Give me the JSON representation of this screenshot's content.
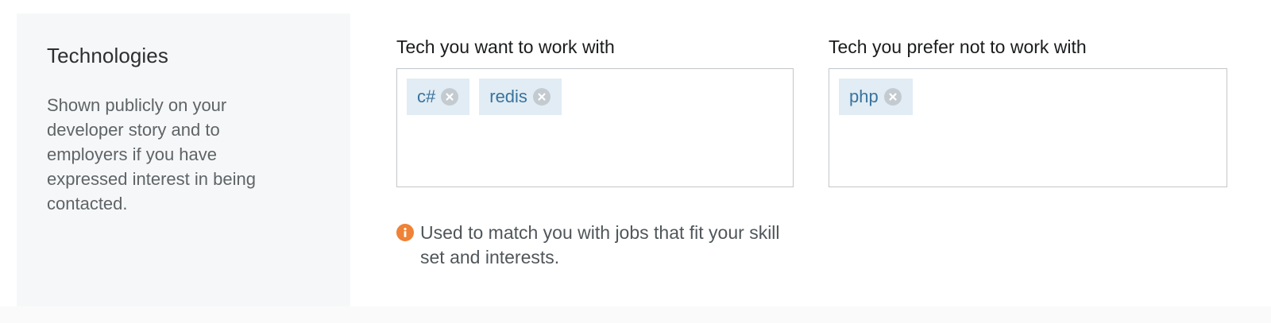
{
  "section": {
    "title": "Technologies",
    "description": "Shown publicly on your developer story and to employers if you have expressed interest in being contacted."
  },
  "want": {
    "label": "Tech you want to work with",
    "tags": [
      "c#",
      "redis"
    ]
  },
  "avoid": {
    "label": "Tech you prefer not to work with",
    "tags": [
      "php"
    ]
  },
  "hint": {
    "icon": "info-icon",
    "text": "Used to match you with jobs that fit your skill set and interests."
  },
  "colors": {
    "tag_background": "#e1ecf4",
    "tag_text": "#39739d",
    "info_icon": "#ef8236"
  }
}
